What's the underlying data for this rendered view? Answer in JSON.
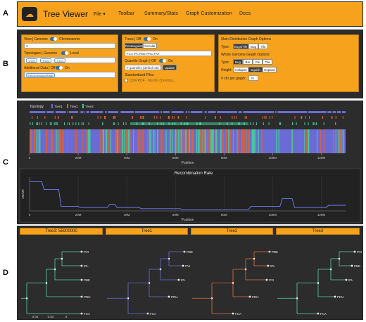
{
  "section_labels": {
    "a": "A",
    "b": "B",
    "c": "C",
    "d": "D"
  },
  "header": {
    "logo_icon": "cloud-icon",
    "title": "Tree Viewer",
    "nav": [
      "File",
      "Toolbar",
      "Summary/Stats",
      "Graph Customization",
      "Docs"
    ],
    "file_caret": "▾"
  },
  "controls": {
    "view_label": "View | Genome",
    "view_right": "Chromosome",
    "chrom_value": "X",
    "topologies_label": "Topologies | Genome",
    "topologies_right": "Local",
    "topology_chips": [
      "Tree1",
      "Tree2",
      "Tree3"
    ],
    "additional_label": "Additional Data | Off",
    "additional_right": "On",
    "additional_chip": "RecombinationRate",
    "trees_label": "Trees | Off",
    "trees_right": "On",
    "tree_shape_buttons": [
      "Rectangular",
      "Circular"
    ],
    "taxa_order": "FCA   IPL   PBE   PRU   PVI",
    "quantile_label": "Quantile Graph | Off",
    "quantile_right": "On",
    "quantile_placeholder": "# quantiles (default 25)",
    "update_label": "Update",
    "standardized_label": "Standardized Files",
    "cdf_label": "CDF/PDF - Not for chromos...",
    "main_dist_title": "Main Distribution Graph Options",
    "type_label": "Type:",
    "main_types": [
      "Bugs/Tile",
      "Bug",
      "Tile"
    ],
    "whole_genome_title": "Whole Genome Graph Options",
    "wg_types": [
      "Bug",
      "Bar",
      "Pie",
      "Tile"
    ],
    "height_label": "Height:",
    "height_options": [
      "Collapse",
      "Squish",
      "Expand"
    ],
    "chr_per_graph_label": "# chr per graph:",
    "chr_per_graph_value": "20"
  },
  "chart_data": [
    {
      "type": "bar",
      "title": "",
      "legend": [
        "Topology",
        "Tree1",
        "Tree2",
        "Tree3"
      ],
      "colors": {
        "Tree1": "#6b6bd6",
        "Tree2": "#d9623a",
        "Tree3": "#3fcf9a"
      },
      "xlabel": "Position",
      "xticks": [
        "0",
        "20M",
        "40M",
        "60M",
        "80M",
        "100M",
        "120M"
      ],
      "xlim": [
        0,
        130
      ]
    },
    {
      "type": "line",
      "title": "Recombination Rate",
      "xlabel": "Position",
      "ylabel": "cM/Mb",
      "xticks": [
        "0",
        "20M",
        "40M",
        "60M",
        "80M",
        "100M",
        "120M"
      ],
      "xlim": [
        0,
        130
      ],
      "ylim": [
        0,
        3
      ],
      "series": [
        {
          "x": [
            0,
            5,
            6,
            12,
            13,
            20,
            21,
            32,
            33,
            35,
            36,
            45,
            46,
            62,
            63,
            90,
            91,
            103,
            104,
            108,
            109,
            122,
            123,
            130
          ],
          "values": [
            2.6,
            2.6,
            1.9,
            1.9,
            0.4,
            0.4,
            0.3,
            0.3,
            0.6,
            0.6,
            0.3,
            0.3,
            0.2,
            0.2,
            0.1,
            0.1,
            0.4,
            0.4,
            1.1,
            1.1,
            0.3,
            0.3,
            0.5,
            0.5
          ]
        }
      ]
    }
  ],
  "trees": [
    {
      "header": "Tree3: 55900000",
      "color": "#5ad3a5",
      "leaves": [
        "PVI",
        "IPL",
        "PBE",
        "PRU",
        "FCA"
      ],
      "scale": [
        "0.04",
        "0.02",
        "0"
      ]
    },
    {
      "header": "Tree1",
      "color": "#6b6bd6",
      "leaves": [
        "PBE",
        "PVI",
        "IPL",
        "PRU",
        "FCA"
      ]
    },
    {
      "header": "Tree2",
      "color": "#e0713f",
      "leaves": [
        "PBE",
        "IPL",
        "PVI",
        "PRU",
        "FCA"
      ]
    },
    {
      "header": "Tree3",
      "color": "#5ad3a5",
      "leaves": [
        "PVI",
        "PBE",
        "IPL",
        "PRU",
        "FCA"
      ]
    }
  ]
}
